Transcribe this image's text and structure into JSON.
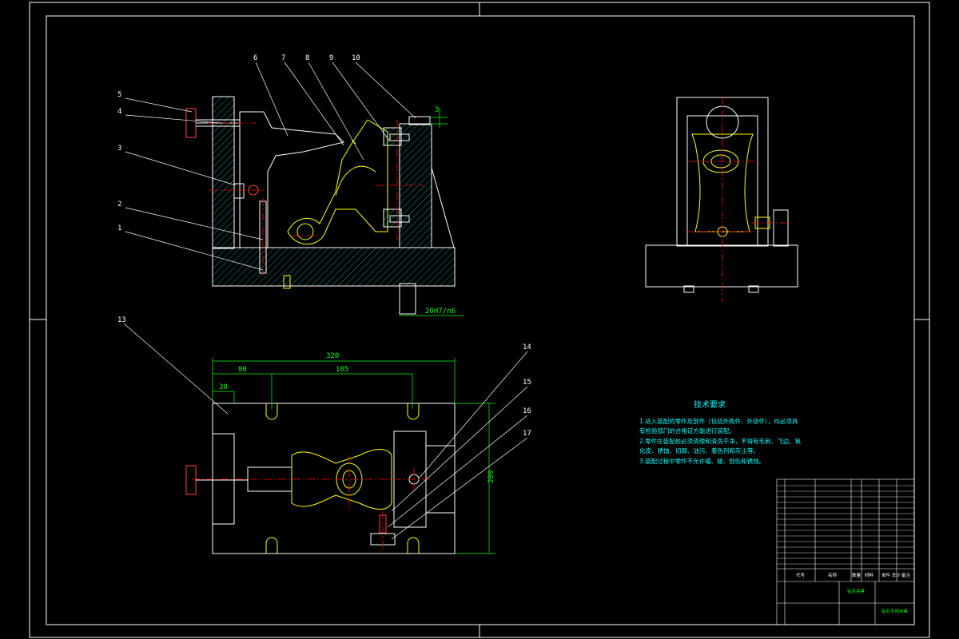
{
  "part_labels": [
    "1",
    "2",
    "3",
    "4",
    "5",
    "6",
    "7",
    "8",
    "9",
    "10",
    "13",
    "14",
    "15",
    "16",
    "17"
  ],
  "dimensions": {
    "gap_top": "3",
    "fit": "20H7/n6",
    "overall_length": "320",
    "offset_80": "80",
    "span_185": "185",
    "width_30": "30",
    "height_200": "200"
  },
  "tech_requirements": {
    "title": "技术要求",
    "lines": [
      "1.进入装配的零件及部件（包括外购件、外协件），均必须具",
      "有检验部门的合格证方能进行装配。",
      "2.零件在装配前必须清理和清洗干净，不得有毛刺、飞边、氧",
      "化皮、锈蚀、切屑、油污、着色剂和灰尘等。",
      "3.装配过程中零件不允许磕、碰、划伤和锈蚀。"
    ]
  },
  "title_block": {
    "drawing_name": "钻床夹具",
    "school": "钻孔专用夹具",
    "col_code": "代号",
    "col_name": "名称",
    "col_qty": "数量",
    "col_material": "材料",
    "col_weight": "单件 总计",
    "col_remark": "备注"
  },
  "colors": {
    "background": "#000000",
    "frame": "#ffffff",
    "part": "#ffff00",
    "centerline": "#ff0000",
    "dimension": "#00ff00",
    "text": "#00ffff",
    "hatch": "#00ffff",
    "leader": "#ffffff"
  }
}
